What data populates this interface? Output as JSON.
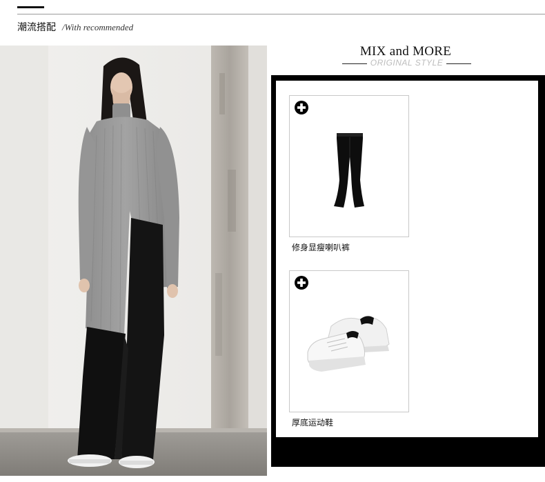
{
  "header": {
    "title": "潮流搭配",
    "subtitle": "/With recommended"
  },
  "hero": {
    "title": "MIX and MORE",
    "subtitle": "ORIGINAL STYLE"
  },
  "products": [
    {
      "name": "修身显瘦喇叭裤",
      "icon": "plus-icon"
    },
    {
      "name": "厚底运动鞋",
      "icon": "plus-icon"
    }
  ],
  "colors": {
    "frame": "#000000",
    "sweater": "#9b9b9b",
    "pants": "#111111",
    "sneaker": "#f4f4f4"
  }
}
